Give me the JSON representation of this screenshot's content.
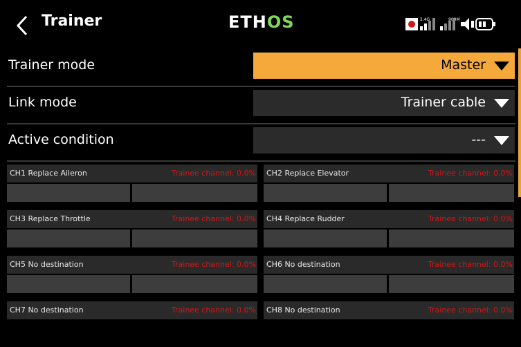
{
  "header": {
    "title": "Trainer",
    "logo_main": "ETH",
    "logo_accent": "OS",
    "signal_24g": "2.4G",
    "signal_900m": "900M"
  },
  "settings": {
    "trainer_mode": {
      "label": "Trainer mode",
      "value": "Master"
    },
    "link_mode": {
      "label": "Link mode",
      "value": "Trainer cable"
    },
    "active_condition": {
      "label": "Active condition",
      "value": "---"
    }
  },
  "channels": [
    {
      "name": "CH1 Replace Aileron",
      "trainee": "Trainee channel: 0.0%"
    },
    {
      "name": "CH2 Replace Elevator",
      "trainee": "Trainee channel: 0.0%"
    },
    {
      "name": "CH3 Replace Throttle",
      "trainee": "Trainee channel: 0.0%"
    },
    {
      "name": "CH4 Replace Rudder",
      "trainee": "Trainee channel: 0.0%"
    },
    {
      "name": "CH5 No destination",
      "trainee": "Trainee channel: 0.0%"
    },
    {
      "name": "CH6 No destination",
      "trainee": "Trainee channel: 0.0%"
    },
    {
      "name": "CH7 No destination",
      "trainee": "Trainee channel: 0.0%"
    },
    {
      "name": "CH8 No destination",
      "trainee": "Trainee channel: 0.0%"
    }
  ],
  "colors": {
    "accent": "#f5a93a",
    "logo_green": "#7ed957",
    "trainee_red": "#d01818",
    "field_bg": "#2b2b2b"
  }
}
